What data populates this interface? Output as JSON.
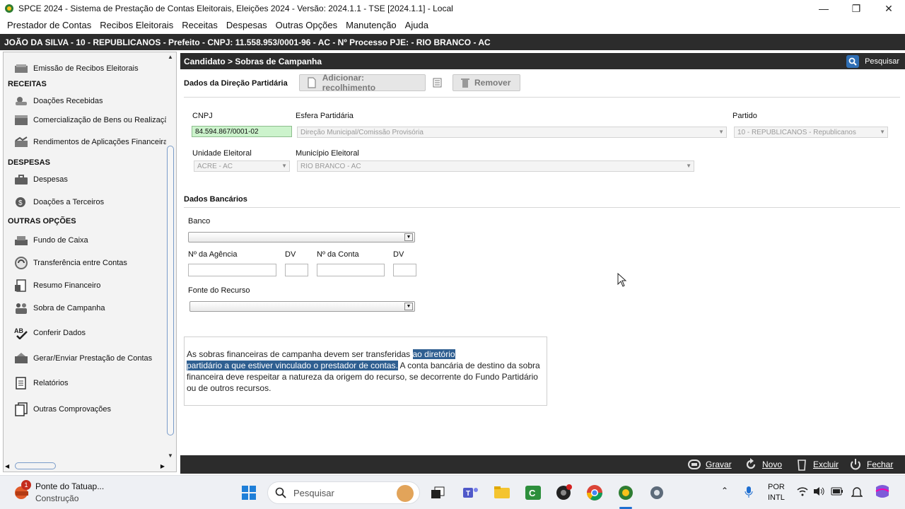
{
  "window": {
    "title": "SPCE 2024 - Sistema de Prestação de Contas Eleitorais, Eleições 2024 - Versão: 2024.1.1  -  TSE [2024.1.1] - Local",
    "minimize": "—",
    "restore": "❐",
    "close": "✕"
  },
  "menu": [
    "Prestador de Contas",
    "Recibos Eleitorais",
    "Receitas",
    "Despesas",
    "Outras Opções",
    "Manutenção",
    "Ajuda"
  ],
  "infobar": "JOÃO DA SILVA - 10 - REPUBLICANOS - Prefeito - CNPJ: 11.558.953/0001-96 - AC - Nº Processo PJE:  - RIO BRANCO - AC",
  "sidebar": {
    "item_recibos": "Emissão de Recibos Eleitorais",
    "head_receitas": "RECEITAS",
    "item_doacoes": "Doações Recebidas",
    "item_comercializacao": "Comercialização de Bens ou Realização de Eventos",
    "item_rendimentos": "Rendimentos de Aplicações Financeiras",
    "head_despesas": "DESPESAS",
    "item_despesas": "Despesas",
    "item_doacoes_terceiros": "Doações a Terceiros",
    "head_outras": "OUTRAS OPÇÕES",
    "item_fundo": "Fundo de Caixa",
    "item_transferencia": "Transferência entre Contas",
    "item_resumo": "Resumo Financeiro",
    "item_sobra": "Sobra de Campanha",
    "item_conferir": "Conferir Dados",
    "item_gerar": "Gerar/Enviar Prestação de Contas",
    "item_relatorios": "Relatórios",
    "item_outras_comprovacoes": "Outras Comprovações"
  },
  "main": {
    "breadcrumb": "Candidato > Sobras de Campanha",
    "search_label": "Pesquisar",
    "section_direcao": "Dados da Direção Partidária",
    "btn_adicionar": "Adicionar: recolhimento",
    "btn_remover": "Remover",
    "cnpj_label": "CNPJ",
    "cnpj_value": "84.594.867/0001-02",
    "esfera_label": "Esfera Partidária",
    "esfera_value": "Direção Municipal/Comissão Provisória",
    "partido_label": "Partido",
    "partido_value": "10 - REPUBLICANOS - Republicanos",
    "unidade_label": "Unidade Eleitoral",
    "unidade_value": "ACRE - AC",
    "municipio_label": "Município Eleitoral",
    "municipio_value": "RIO BRANCO - AC",
    "section_bancarios": "Dados Bancários",
    "banco_label": "Banco",
    "agencia_label": "Nº da Agência",
    "dv1_label": "DV",
    "conta_label": "Nº da Conta",
    "dv2_label": "DV",
    "fonte_label": "Fonte do Recurso",
    "note_part1": "As sobras financeiras de campanha devem ser transferidas ",
    "note_hl1": "ao diretório",
    "note_hl2": "partidário a que estiver vinculado o prestador de contas.",
    "note_part2": " A conta bancária de destino da sobra financeira deve respeitar a natureza da origem do recurso, se decorrente do Fundo Partidário ou de outros recursos."
  },
  "footer": {
    "gravar": "Gravar",
    "novo": "Novo",
    "excluir": "Excluir",
    "fechar": "Fechar"
  },
  "taskbar": {
    "weather_title": "Ponte do Tatuap...",
    "weather_sub": "Construção",
    "weather_badge": "1",
    "search_placeholder": "Pesquisar",
    "lang_1": "POR",
    "lang_2": "INTL"
  }
}
